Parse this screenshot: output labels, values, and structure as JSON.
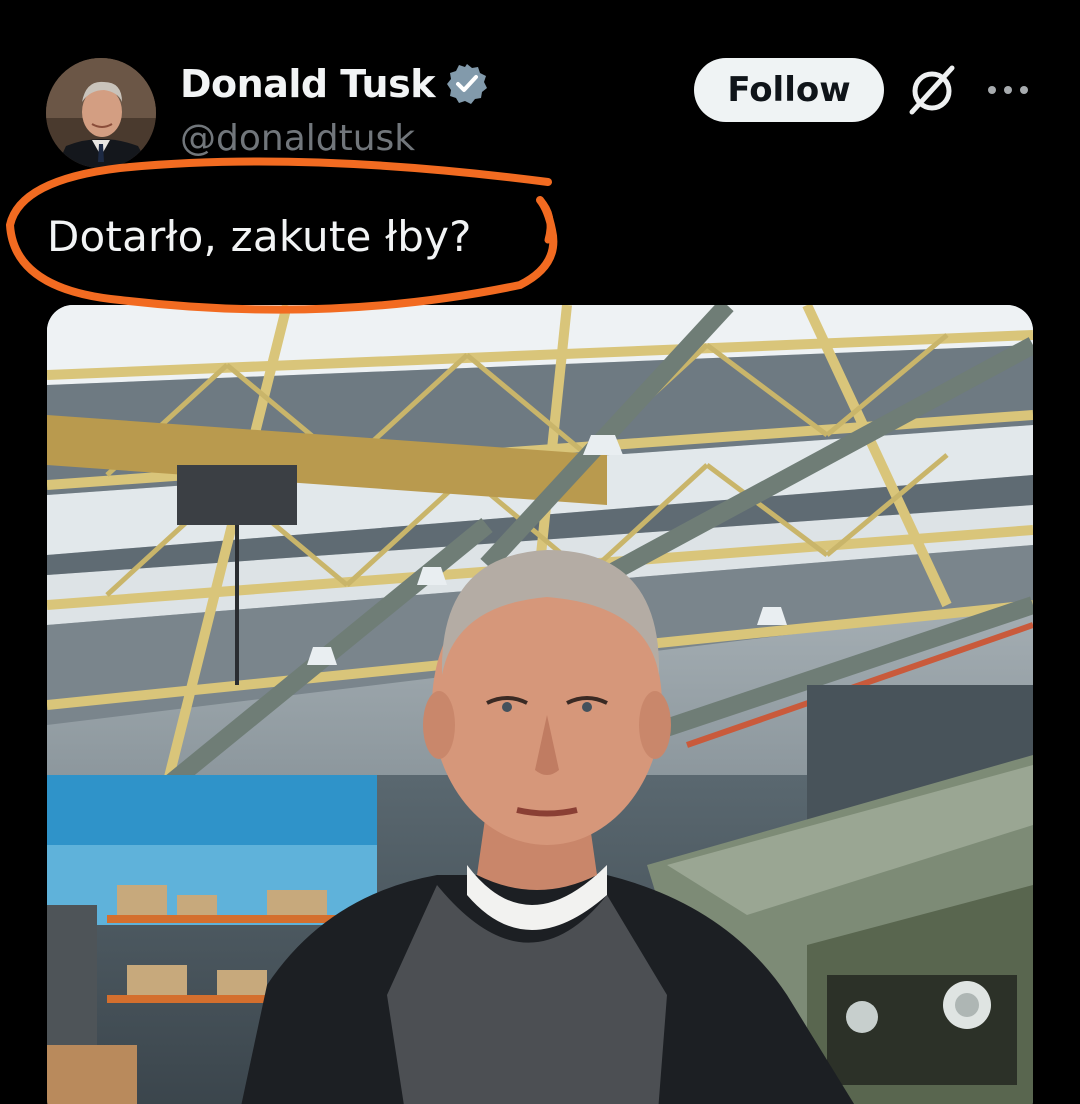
{
  "post": {
    "author": {
      "display_name": "Donald Tusk",
      "handle": "@donaldtusk",
      "verified": true
    },
    "follow_label": "Follow",
    "text": "Dotarło, zakute łby?",
    "icons": {
      "verified": "verified-badge-icon",
      "grok": "grok-icon",
      "more": "more-options-icon"
    },
    "colors": {
      "background": "#000000",
      "text": "#f2f4f5",
      "muted": "#71767b",
      "verified_badge": "#829aab",
      "follow_bg": "#eff3f4",
      "highlight_circle": "#f26b21"
    }
  }
}
